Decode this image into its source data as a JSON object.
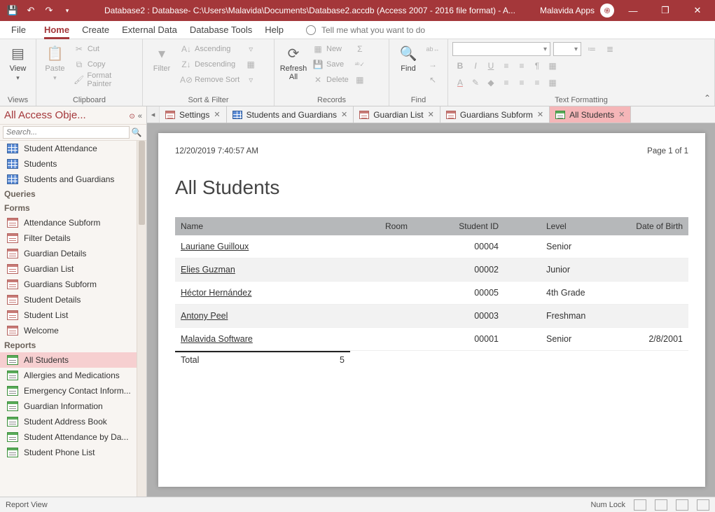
{
  "titlebar": {
    "title": "Database2 : Database- C:\\Users\\Malavida\\Documents\\Database2.accdb (Access 2007 - 2016 file format) -  A...",
    "app_label": "Malavida Apps"
  },
  "ribbon_tabs": {
    "file": "File",
    "home": "Home",
    "create": "Create",
    "external": "External Data",
    "dbtools": "Database Tools",
    "help": "Help",
    "tellme": "Tell me what you want to do"
  },
  "ribbon": {
    "views": {
      "label": "Views",
      "view": "View"
    },
    "clipboard": {
      "label": "Clipboard",
      "paste": "Paste",
      "cut": "Cut",
      "copy": "Copy",
      "fmt": "Format Painter"
    },
    "sortfilter": {
      "label": "Sort & Filter",
      "filter": "Filter",
      "asc": "Ascending",
      "desc": "Descending",
      "remove": "Remove Sort"
    },
    "records": {
      "label": "Records",
      "refresh": "Refresh\nAll",
      "new": "New",
      "save": "Save",
      "delete": "Delete"
    },
    "find": {
      "label": "Find",
      "find": "Find"
    },
    "textfmt": {
      "label": "Text Formatting"
    }
  },
  "nav": {
    "title": "All Access Obje...",
    "search_placeholder": "Search...",
    "groups": {
      "queries": "Queries",
      "forms": "Forms",
      "reports": "Reports"
    },
    "tables": [
      "Student Attendance",
      "Students",
      "Students and Guardians"
    ],
    "forms": [
      "Attendance Subform",
      "Filter Details",
      "Guardian Details",
      "Guardian List",
      "Guardians Subform",
      "Student Details",
      "Student List",
      "Welcome"
    ],
    "reports": [
      "All Students",
      "Allergies and Medications",
      "Emergency Contact Inform...",
      "Guardian Information",
      "Student Address Book",
      "Student Attendance by Da...",
      "Student Phone List"
    ]
  },
  "doctabs": [
    {
      "label": "Settings",
      "type": "form"
    },
    {
      "label": "Students and Guardians",
      "type": "table"
    },
    {
      "label": "Guardian List",
      "type": "form"
    },
    {
      "label": "Guardians Subform",
      "type": "form"
    },
    {
      "label": "All Students",
      "type": "report",
      "active": true
    }
  ],
  "report": {
    "timestamp": "12/20/2019 7:40:57 AM",
    "pageinfo": "Page 1 of 1",
    "title": "All Students",
    "columns": {
      "name": "Name",
      "room": "Room",
      "id": "Student ID",
      "level": "Level",
      "dob": "Date of Birth"
    },
    "rows": [
      {
        "name": "Lauriane Guilloux",
        "room": "",
        "id": "00004",
        "level": "Senior",
        "dob": ""
      },
      {
        "name": "Elies Guzman",
        "room": "",
        "id": "00002",
        "level": "Junior",
        "dob": ""
      },
      {
        "name": "Héctor Hernández",
        "room": "",
        "id": "00005",
        "level": "4th Grade",
        "dob": ""
      },
      {
        "name": "Antony Peel",
        "room": "",
        "id": "00003",
        "level": "Freshman",
        "dob": ""
      },
      {
        "name": "Malavida Software",
        "room": "",
        "id": "00001",
        "level": "Senior",
        "dob": "2/8/2001"
      }
    ],
    "total_label": "Total",
    "total_value": "5"
  },
  "statusbar": {
    "left": "Report View",
    "numlock": "Num Lock"
  }
}
